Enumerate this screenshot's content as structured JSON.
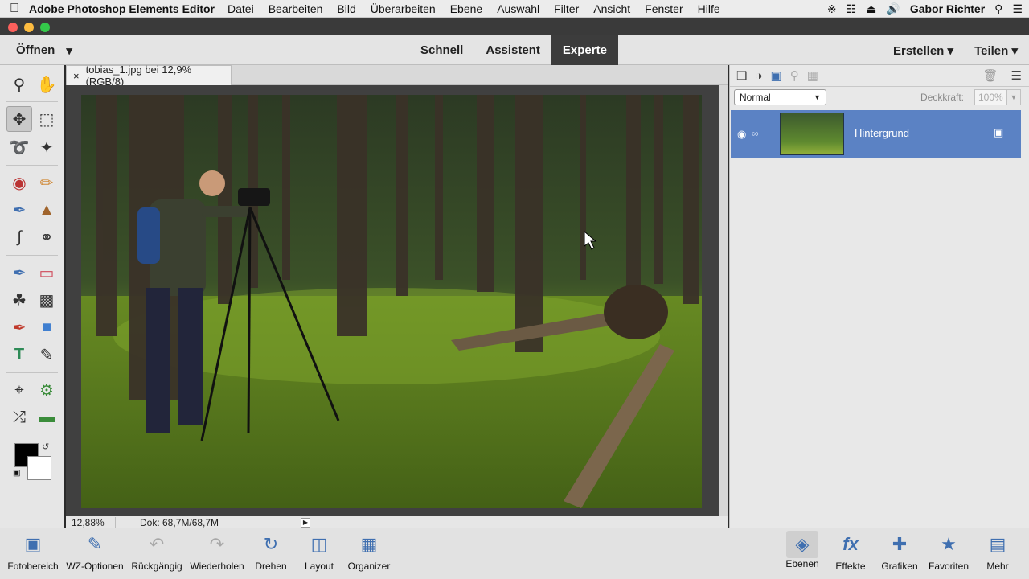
{
  "menubar": {
    "app_name": "Adobe Photoshop Elements Editor",
    "items": [
      "Datei",
      "Bearbeiten",
      "Bild",
      "Überarbeiten",
      "Ebene",
      "Auswahl",
      "Filter",
      "Ansicht",
      "Fenster",
      "Hilfe"
    ],
    "user": "Gabor Richter"
  },
  "topbar": {
    "open_label": "Öffnen",
    "modes": [
      "Schnell",
      "Assistent",
      "Experte"
    ],
    "active_mode": "Experte",
    "create_label": "Erstellen",
    "share_label": "Teilen"
  },
  "document": {
    "tab_title": "tobias_1.jpg bei 12,9% (RGB/8)",
    "zoom": "12,88%",
    "doc_size": "Dok: 68,7M/68,7M"
  },
  "layers": {
    "blend_mode": "Normal",
    "opacity_label": "Deckkraft:",
    "opacity_value": "100%",
    "items": [
      {
        "name": "Hintergrund",
        "selected": true
      }
    ]
  },
  "taskbar": {
    "left": [
      "Fotobereich",
      "WZ-Optionen",
      "Rückgängig",
      "Wiederholen",
      "Drehen",
      "Layout",
      "Organizer"
    ],
    "right": [
      "Ebenen",
      "Effekte",
      "Grafiken",
      "Favoriten",
      "Mehr"
    ]
  },
  "colors": {
    "accent": "#5b82c4",
    "icon_blue": "#3f6fb0",
    "foreground": "#000000",
    "background": "#ffffff"
  }
}
